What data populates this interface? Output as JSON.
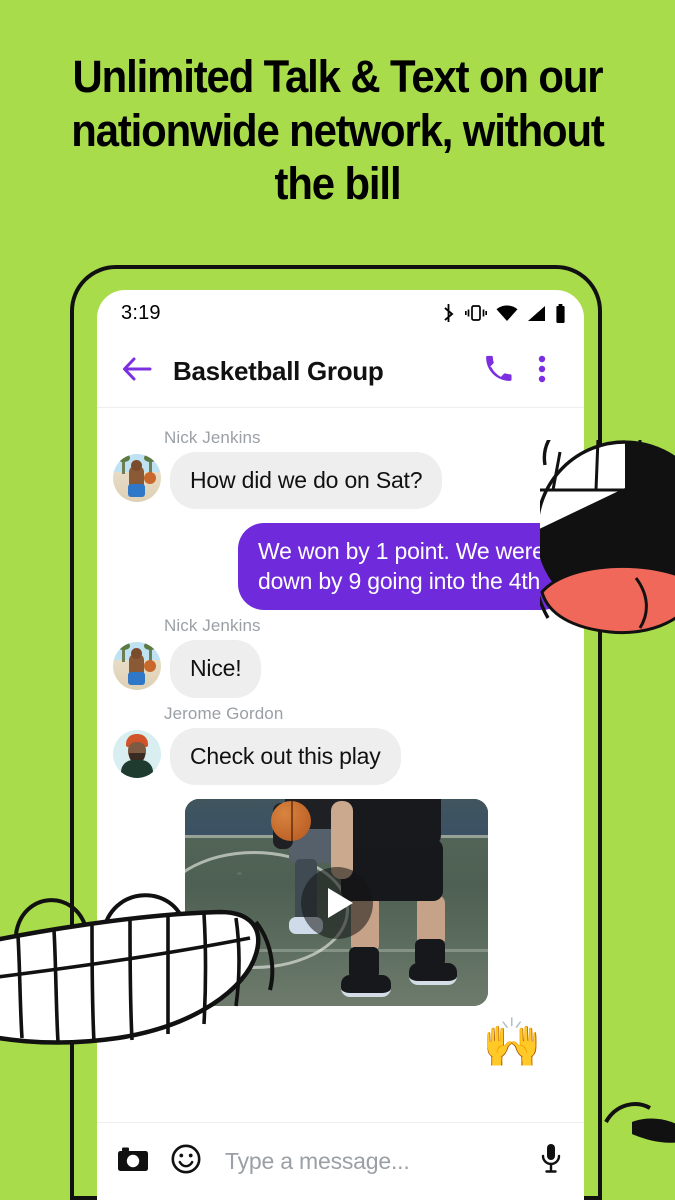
{
  "promo": {
    "headline_lines": [
      "Unlimited Talk & Text on our",
      "nationwide network, without",
      "the bill"
    ],
    "background_color": "#a8dc4a",
    "accent_color": "#6f2bdb"
  },
  "phone": {
    "status_bar": {
      "time": "3:19",
      "icons": [
        "bluetooth-icon",
        "vibrate-icon",
        "wifi-icon",
        "cellular-signal-icon",
        "battery-icon"
      ]
    },
    "app_bar": {
      "back_label": "back-arrow",
      "title": "Basketball Group",
      "call_label": "call",
      "menu_label": "more-options"
    },
    "thread": [
      {
        "type": "incoming",
        "sender": "Nick Jenkins",
        "text": "How did we do on Sat?",
        "avatar": "nick-avatar"
      },
      {
        "type": "outgoing",
        "sender": "",
        "text": "We won by 1 point. We were down by 9 going into the 4th",
        "avatar": ""
      },
      {
        "type": "incoming",
        "sender": "Nick Jenkins",
        "text": "Nice!",
        "avatar": "nick-avatar"
      },
      {
        "type": "incoming",
        "sender": "Jerome Gordon",
        "text": "Check out this play",
        "avatar": "jerome-avatar"
      }
    ],
    "video_message": {
      "caption": "",
      "play_button_label": "play"
    },
    "reaction": {
      "emoji": "🙌"
    },
    "composer": {
      "camera_label": "camera",
      "emoji_label": "emoji",
      "placeholder": "Type a message...",
      "value": "",
      "mic_label": "microphone"
    }
  },
  "decorations": {
    "mouth_doodle": "open-mouth-doodle",
    "teeth_doodle": "grin-teeth-doodle",
    "brow_doodle": "eyebrow-doodle"
  }
}
